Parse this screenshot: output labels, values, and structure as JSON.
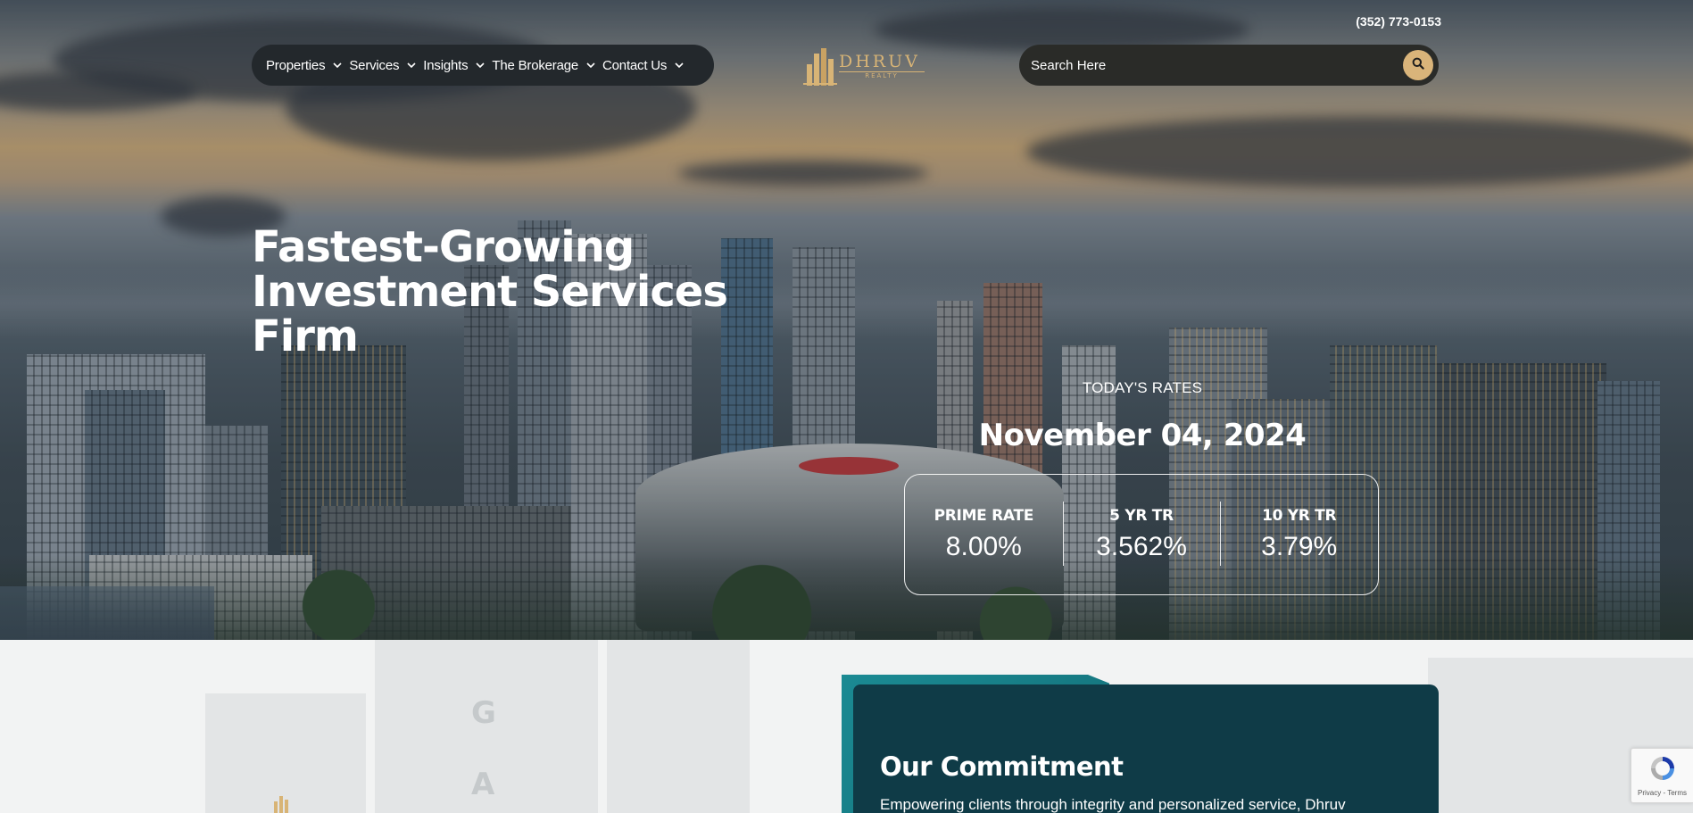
{
  "header": {
    "phone": "(352) 773-0153",
    "nav": [
      {
        "label": "Properties"
      },
      {
        "label": "Services"
      },
      {
        "label": "Insights"
      },
      {
        "label": "The Brokerage"
      },
      {
        "label": "Contact Us"
      }
    ],
    "logo": {
      "name": "DHRUV",
      "sub": "REALTY"
    },
    "search": {
      "placeholder": "Search Here"
    }
  },
  "hero": {
    "title_lines": [
      "Fastest-Growing",
      "Investment Services",
      "Firm"
    ],
    "rates": {
      "label": "TODAY'S RATES",
      "date": "November 04, 2024",
      "items": [
        {
          "name": "PRIME RATE",
          "value": "8.00%"
        },
        {
          "name": "5 YR TR",
          "value": "3.562%"
        },
        {
          "name": "10 YR TR",
          "value": "3.79%"
        }
      ]
    }
  },
  "commitment": {
    "title": "Our Commitment",
    "text": "Empowering clients through integrity and personalized service, Dhruv"
  },
  "recaptcha": {
    "sub": "Privacy - Terms"
  },
  "colors": {
    "accent_gold": "#d9b47a",
    "card_bg": "#0f3b47",
    "card_accent": "#1b8a93",
    "nav_bg": "#23282c"
  },
  "icons": [
    "chevron-down-icon",
    "search-icon",
    "logo-building-icon",
    "recaptcha-icon"
  ]
}
